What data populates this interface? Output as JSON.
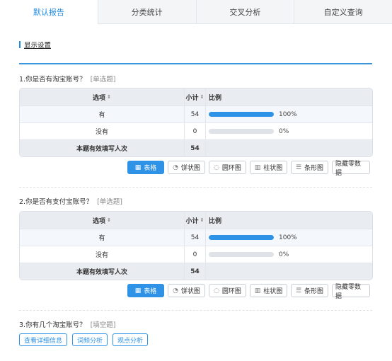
{
  "tabs": [
    "默认报告",
    "分类统计",
    "交叉分析",
    "自定义查询"
  ],
  "display_settings": "显示设置",
  "table_headers": {
    "option": "选项",
    "count": "小计",
    "ratio": "比例",
    "sort": "⇕"
  },
  "chart_buttons": {
    "table": "表格",
    "pie": "饼状图",
    "ring": "圆环图",
    "column": "柱状图",
    "bar": "条形图",
    "hide_zero": "隐藏零数据"
  },
  "q1": {
    "title": "1.你是否有淘宝账号？",
    "type": "[单选题]",
    "rows": [
      {
        "option": "有",
        "count": "54",
        "percent": "100%",
        "fill": 100
      },
      {
        "option": "没有",
        "count": "0",
        "percent": "0%",
        "fill": 0
      }
    ],
    "total_label": "本题有效填写人次",
    "total": "54"
  },
  "q2": {
    "title": "2.你是否有支付宝账号？",
    "type": "[单选题]",
    "rows": [
      {
        "option": "有",
        "count": "54",
        "percent": "100%",
        "fill": 100
      },
      {
        "option": "没有",
        "count": "0",
        "percent": "0%",
        "fill": 0
      }
    ],
    "total_label": "本题有效填写人次",
    "total": "54"
  },
  "q3": {
    "title": "3.你有几个淘宝账号？",
    "type": "[填空题]",
    "buttons": [
      "查看详细信息",
      "词频分析",
      "观点分析"
    ]
  },
  "colors": {
    "accent": "#2e93e6",
    "header_bg": "#e9ecf0"
  }
}
